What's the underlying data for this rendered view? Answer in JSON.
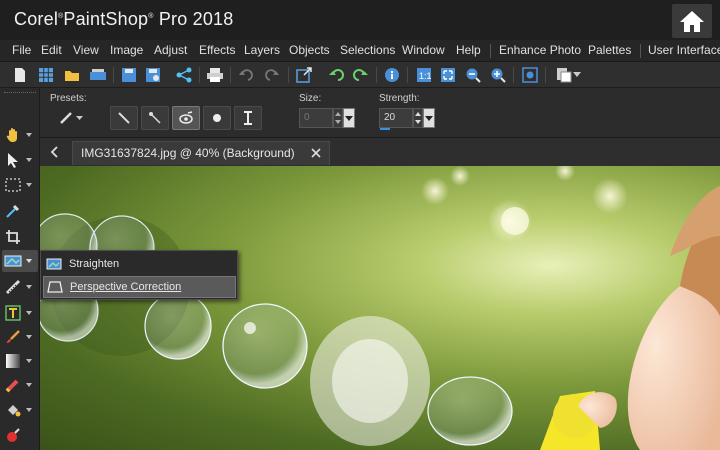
{
  "app": {
    "title_brand": "Corel",
    "title_product": "PaintShop",
    "title_rest": "Pro 2018",
    "home_icon": "home-icon"
  },
  "menu": {
    "items": [
      "File",
      "Edit",
      "View",
      "Image",
      "Adjust",
      "Effects",
      "Layers",
      "Objects",
      "Selections",
      "Window",
      "Help",
      "Enhance Photo",
      "Palettes",
      "User Interface"
    ]
  },
  "toolbar": {
    "icons": [
      "new-icon",
      "grid-icon",
      "open-folder-icon",
      "scanner-icon",
      "save-icon",
      "save-as-icon",
      "share-icon",
      "print-icon",
      "undo-icon",
      "redo-icon",
      "resize-icon",
      "rotate-left-icon",
      "rotate-right-icon",
      "info-icon",
      "actual-size-icon",
      "fit-window-icon",
      "zoom-out-icon",
      "zoom-in-icon",
      "zoom-fit-icon",
      "paste-icon"
    ]
  },
  "options": {
    "presets_label": "Presets:",
    "size_label": "Size:",
    "size_value": "0",
    "strength_label": "Strength:",
    "strength_value": "20"
  },
  "tools": {
    "items": [
      "pan-icon",
      "pick-icon",
      "selection-icon",
      "dropper-icon",
      "crop-icon",
      "straighten-icon",
      "perspective-icon",
      "text-icon",
      "paint-brush-icon",
      "gradient-icon",
      "eraser-icon",
      "fill-icon",
      "red-eye-icon"
    ]
  },
  "document": {
    "tab_label": "IMG31637824.jpg @  40% (Background)"
  },
  "flyout": {
    "items": [
      "Straighten",
      "Perspective Correction"
    ]
  },
  "colors": {
    "accent": "#3a8ee6",
    "panel": "#2b2b2b"
  }
}
